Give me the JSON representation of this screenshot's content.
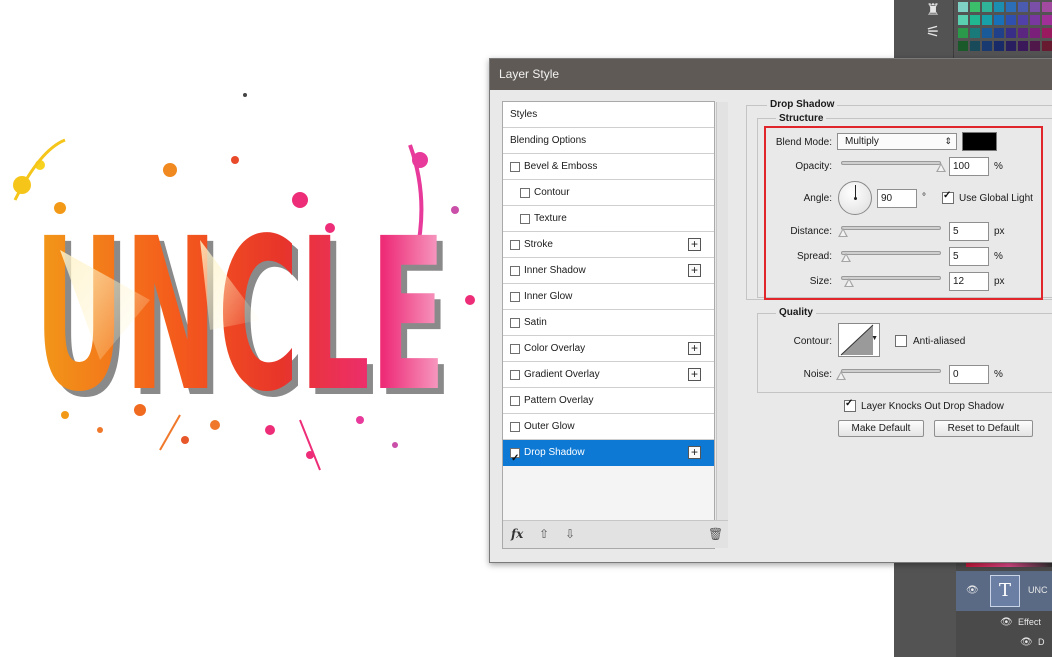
{
  "canvas": {
    "art_text": "UNCLE"
  },
  "dialog": {
    "title": "Layer Style",
    "styles_list": {
      "items": [
        {
          "label": "Styles",
          "checkbox": false,
          "checked": false,
          "plus": false,
          "selected": false
        },
        {
          "label": "Blending Options",
          "checkbox": false,
          "checked": false,
          "plus": false,
          "selected": false
        },
        {
          "label": "Bevel & Emboss",
          "checkbox": true,
          "checked": false,
          "plus": false,
          "selected": false
        },
        {
          "label": "Contour",
          "checkbox": true,
          "checked": false,
          "plus": false,
          "selected": false,
          "indent": true
        },
        {
          "label": "Texture",
          "checkbox": true,
          "checked": false,
          "plus": false,
          "selected": false,
          "indent": true
        },
        {
          "label": "Stroke",
          "checkbox": true,
          "checked": false,
          "plus": true,
          "selected": false
        },
        {
          "label": "Inner Shadow",
          "checkbox": true,
          "checked": false,
          "plus": true,
          "selected": false
        },
        {
          "label": "Inner Glow",
          "checkbox": true,
          "checked": false,
          "plus": false,
          "selected": false
        },
        {
          "label": "Satin",
          "checkbox": true,
          "checked": false,
          "plus": false,
          "selected": false
        },
        {
          "label": "Color Overlay",
          "checkbox": true,
          "checked": false,
          "plus": true,
          "selected": false
        },
        {
          "label": "Gradient Overlay",
          "checkbox": true,
          "checked": false,
          "plus": true,
          "selected": false
        },
        {
          "label": "Pattern Overlay",
          "checkbox": true,
          "checked": false,
          "plus": false,
          "selected": false
        },
        {
          "label": "Outer Glow",
          "checkbox": true,
          "checked": false,
          "plus": false,
          "selected": false
        },
        {
          "label": "Drop Shadow",
          "checkbox": true,
          "checked": true,
          "plus": true,
          "selected": true
        }
      ],
      "bottom_icons": {
        "fx": "fx",
        "up": "arrow-up-icon",
        "down": "arrow-down-icon",
        "trash": "trash-icon"
      }
    },
    "drop_shadow": {
      "section_title": "Drop Shadow",
      "structure_title": "Structure",
      "blend_mode_label": "Blend Mode:",
      "blend_mode_value": "Multiply",
      "shadow_color": "#000000",
      "opacity_label": "Opacity:",
      "opacity_value": "100",
      "opacity_unit": "%",
      "opacity_fraction": 1.0,
      "angle_label": "Angle:",
      "angle_value": "90",
      "angle_unit": "°",
      "use_global_light_label": "Use Global Light",
      "use_global_light_checked": true,
      "distance_label": "Distance:",
      "distance_value": "5",
      "distance_unit": "px",
      "distance_fraction": 0.02,
      "spread_label": "Spread:",
      "spread_value": "5",
      "spread_unit": "%",
      "spread_fraction": 0.05,
      "size_label": "Size:",
      "size_value": "12",
      "size_unit": "px",
      "size_fraction": 0.08
    },
    "quality": {
      "section_title": "Quality",
      "contour_label": "Contour:",
      "anti_aliased_label": "Anti-aliased",
      "anti_aliased_checked": false,
      "noise_label": "Noise:",
      "noise_value": "0",
      "noise_unit": "%",
      "noise_fraction": 0.0
    },
    "layer_knocks_label": "Layer Knocks Out Drop Shadow",
    "layer_knocks_checked": true,
    "make_default_label": "Make Default",
    "reset_default_label": "Reset to Default"
  },
  "layers_panel": {
    "layer_name": "UNC",
    "effects_label": "Effect",
    "sub_label": "D"
  },
  "colors": {
    "highlight": "#e0252b",
    "selection": "#0d79d5",
    "title_bar": "#5f5a55",
    "panel_dark": "#535353"
  }
}
